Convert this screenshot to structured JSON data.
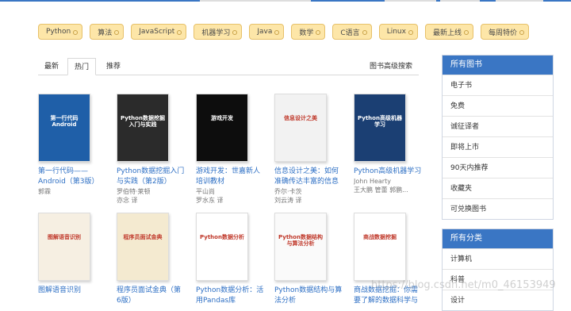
{
  "tags": [
    "Python",
    "算法",
    "JavaScript",
    "机器学习",
    "Java",
    "数学",
    "C语言",
    "Linux",
    "最新上线",
    "每周特价"
  ],
  "tabs": {
    "items": [
      "最新",
      "热门",
      "推荐"
    ],
    "advanced_search": "图书高级搜索"
  },
  "books": [
    {
      "title": "第一行代码——Android（第3版）",
      "author": "郭霖",
      "translator": "",
      "cover_text": "第一行代码 Android",
      "cover_color": "#1f5fa8"
    },
    {
      "title": "Python数据挖掘入门与实践（第2版）",
      "author": "罗伯特·莱顿",
      "translator": "亦念  译",
      "cover_text": "Python数据挖掘入门与实践",
      "cover_color": "#2b2b2b"
    },
    {
      "title": "游戏开发：世嘉新人培训教材",
      "author": "平山尚",
      "translator": "罗水东  译",
      "cover_text": "游戏开发",
      "cover_color": "#0d0d0d"
    },
    {
      "title": "信息设计之美：如何准确传达丰富的信息",
      "author": "乔尔·卡茨",
      "translator": "刘云涛  译",
      "cover_text": "信息设计之美",
      "cover_color": "#f2f2f2"
    },
    {
      "title": "Python高级机器学习",
      "author": "John Hearty",
      "translator": "王大鹏 管蕾 郭鹏...",
      "cover_text": "Python高级机器学习",
      "cover_color": "#1b3f73"
    },
    {
      "title": "图解语音识别",
      "author": "",
      "translator": "",
      "cover_text": "图解语音识别",
      "cover_color": "#f6efe2"
    },
    {
      "title": "程序员面试金典（第6版）",
      "author": "",
      "translator": "",
      "cover_text": "程序员面试金典",
      "cover_color": "#f4ead0"
    },
    {
      "title": "Python数据分析：活用Pandas库",
      "author": "",
      "translator": "",
      "cover_text": "Python数据分析",
      "cover_color": "#ffffff"
    },
    {
      "title": "Python数据结构与算法分析",
      "author": "",
      "translator": "",
      "cover_text": "Python数据结构与算法分析",
      "cover_color": "#fafafa"
    },
    {
      "title": "商战数据挖掘：你需要了解的数据科学与分析思维",
      "author": "",
      "translator": "",
      "cover_text": "商战数据挖掘",
      "cover_color": "#ffffff"
    }
  ],
  "sidebar_all": {
    "title": "所有图书",
    "items": [
      "电子书",
      "免费",
      "诚征译者",
      "即将上市",
      "90天内推荐",
      "收藏夹",
      "可兑换图书"
    ]
  },
  "sidebar_cats": {
    "title": "所有分类",
    "items": [
      "计算机",
      "科普",
      "设计"
    ]
  },
  "watermark": "https://blog.csdn.net/m0_46153949"
}
